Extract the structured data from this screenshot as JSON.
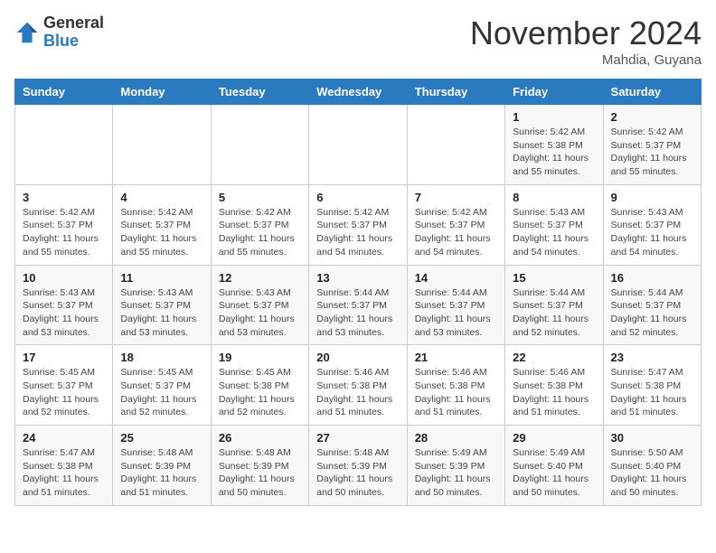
{
  "header": {
    "logo_general": "General",
    "logo_blue": "Blue",
    "month": "November 2024",
    "location": "Mahdia, Guyana"
  },
  "weekdays": [
    "Sunday",
    "Monday",
    "Tuesday",
    "Wednesday",
    "Thursday",
    "Friday",
    "Saturday"
  ],
  "weeks": [
    [
      {
        "day": "",
        "info": ""
      },
      {
        "day": "",
        "info": ""
      },
      {
        "day": "",
        "info": ""
      },
      {
        "day": "",
        "info": ""
      },
      {
        "day": "",
        "info": ""
      },
      {
        "day": "1",
        "info": "Sunrise: 5:42 AM\nSunset: 5:38 PM\nDaylight: 11 hours\nand 55 minutes."
      },
      {
        "day": "2",
        "info": "Sunrise: 5:42 AM\nSunset: 5:37 PM\nDaylight: 11 hours\nand 55 minutes."
      }
    ],
    [
      {
        "day": "3",
        "info": "Sunrise: 5:42 AM\nSunset: 5:37 PM\nDaylight: 11 hours\nand 55 minutes."
      },
      {
        "day": "4",
        "info": "Sunrise: 5:42 AM\nSunset: 5:37 PM\nDaylight: 11 hours\nand 55 minutes."
      },
      {
        "day": "5",
        "info": "Sunrise: 5:42 AM\nSunset: 5:37 PM\nDaylight: 11 hours\nand 55 minutes."
      },
      {
        "day": "6",
        "info": "Sunrise: 5:42 AM\nSunset: 5:37 PM\nDaylight: 11 hours\nand 54 minutes."
      },
      {
        "day": "7",
        "info": "Sunrise: 5:42 AM\nSunset: 5:37 PM\nDaylight: 11 hours\nand 54 minutes."
      },
      {
        "day": "8",
        "info": "Sunrise: 5:43 AM\nSunset: 5:37 PM\nDaylight: 11 hours\nand 54 minutes."
      },
      {
        "day": "9",
        "info": "Sunrise: 5:43 AM\nSunset: 5:37 PM\nDaylight: 11 hours\nand 54 minutes."
      }
    ],
    [
      {
        "day": "10",
        "info": "Sunrise: 5:43 AM\nSunset: 5:37 PM\nDaylight: 11 hours\nand 53 minutes."
      },
      {
        "day": "11",
        "info": "Sunrise: 5:43 AM\nSunset: 5:37 PM\nDaylight: 11 hours\nand 53 minutes."
      },
      {
        "day": "12",
        "info": "Sunrise: 5:43 AM\nSunset: 5:37 PM\nDaylight: 11 hours\nand 53 minutes."
      },
      {
        "day": "13",
        "info": "Sunrise: 5:44 AM\nSunset: 5:37 PM\nDaylight: 11 hours\nand 53 minutes."
      },
      {
        "day": "14",
        "info": "Sunrise: 5:44 AM\nSunset: 5:37 PM\nDaylight: 11 hours\nand 53 minutes."
      },
      {
        "day": "15",
        "info": "Sunrise: 5:44 AM\nSunset: 5:37 PM\nDaylight: 11 hours\nand 52 minutes."
      },
      {
        "day": "16",
        "info": "Sunrise: 5:44 AM\nSunset: 5:37 PM\nDaylight: 11 hours\nand 52 minutes."
      }
    ],
    [
      {
        "day": "17",
        "info": "Sunrise: 5:45 AM\nSunset: 5:37 PM\nDaylight: 11 hours\nand 52 minutes."
      },
      {
        "day": "18",
        "info": "Sunrise: 5:45 AM\nSunset: 5:37 PM\nDaylight: 11 hours\nand 52 minutes."
      },
      {
        "day": "19",
        "info": "Sunrise: 5:45 AM\nSunset: 5:38 PM\nDaylight: 11 hours\nand 52 minutes."
      },
      {
        "day": "20",
        "info": "Sunrise: 5:46 AM\nSunset: 5:38 PM\nDaylight: 11 hours\nand 51 minutes."
      },
      {
        "day": "21",
        "info": "Sunrise: 5:46 AM\nSunset: 5:38 PM\nDaylight: 11 hours\nand 51 minutes."
      },
      {
        "day": "22",
        "info": "Sunrise: 5:46 AM\nSunset: 5:38 PM\nDaylight: 11 hours\nand 51 minutes."
      },
      {
        "day": "23",
        "info": "Sunrise: 5:47 AM\nSunset: 5:38 PM\nDaylight: 11 hours\nand 51 minutes."
      }
    ],
    [
      {
        "day": "24",
        "info": "Sunrise: 5:47 AM\nSunset: 5:38 PM\nDaylight: 11 hours\nand 51 minutes."
      },
      {
        "day": "25",
        "info": "Sunrise: 5:48 AM\nSunset: 5:39 PM\nDaylight: 11 hours\nand 51 minutes."
      },
      {
        "day": "26",
        "info": "Sunrise: 5:48 AM\nSunset: 5:39 PM\nDaylight: 11 hours\nand 50 minutes."
      },
      {
        "day": "27",
        "info": "Sunrise: 5:48 AM\nSunset: 5:39 PM\nDaylight: 11 hours\nand 50 minutes."
      },
      {
        "day": "28",
        "info": "Sunrise: 5:49 AM\nSunset: 5:39 PM\nDaylight: 11 hours\nand 50 minutes."
      },
      {
        "day": "29",
        "info": "Sunrise: 5:49 AM\nSunset: 5:40 PM\nDaylight: 11 hours\nand 50 minutes."
      },
      {
        "day": "30",
        "info": "Sunrise: 5:50 AM\nSunset: 5:40 PM\nDaylight: 11 hours\nand 50 minutes."
      }
    ]
  ]
}
